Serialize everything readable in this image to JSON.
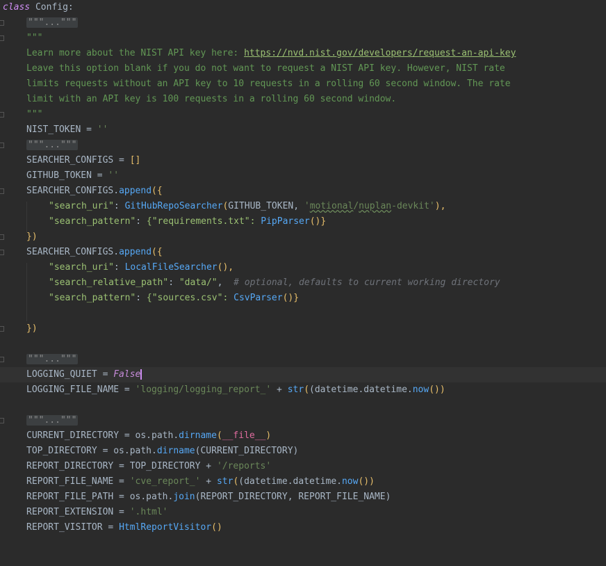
{
  "editor": {
    "lines": {
      "l1_kw": "class",
      "l1_name": " Config:",
      "fold": "\"\"\"...\"\"\"",
      "doc_open": "\"\"\"",
      "doc_l1_text": "Learn more about the NIST API key here: ",
      "doc_l1_link": "https://nvd.nist.gov/developers/request-an-api-key",
      "doc_l2": "Leave this option blank if you do not want to request a NIST API key. However, NIST rate",
      "doc_l3": "limits requests without an API key to 10 requests in a rolling 60 second window. The rate",
      "doc_l4": "limit with an API key is 100 requests in a rolling 60 second window.",
      "doc_close": "\"\"\"",
      "nist_token": "NIST_TOKEN = ",
      "nist_token_val": "''",
      "searcher_configs": "SEARCHER_CONFIGS = ",
      "searcher_configs_val": "[]",
      "github_token": "GITHUB_TOKEN = ",
      "github_token_val": "''",
      "sc_append_1": "SEARCHER_CONFIGS.",
      "append": "append",
      "open_paren_brace": "({",
      "search_uri_key": "\"search_uri\"",
      "colon": ": ",
      "github_repo_searcher": "GitHubRepoSearcher",
      "github_args_open": "(",
      "github_args_token": "GITHUB_TOKEN, ",
      "github_args_repo_q1": "'",
      "github_args_repo_a": "motional",
      "github_args_repo_slash": "/",
      "github_args_repo_b": "nuplan",
      "github_args_repo_c": "-devkit",
      "github_args_repo_q2": "'",
      "github_args_close": "),",
      "search_pattern_key": "\"search_pattern\"",
      "req_txt": "{\"requirements.txt\": ",
      "pip_parser": "PipParser",
      "pip_parser_call": "()}",
      "close_brace_paren": "})",
      "sc_append_2": "SEARCHER_CONFIGS.",
      "local_file_searcher": "LocalFileSearcher",
      "local_call": "(),",
      "search_rel_path_key": "\"search_relative_path\"",
      "data_path": "\"data/\"",
      "comma_sp": ",  ",
      "rel_comment": "# optional, defaults to current working directory",
      "sources_csv": "{\"sources.csv\": ",
      "csv_parser": "CsvParser",
      "csv_call": "()}",
      "close_brace_paren_2": "})",
      "logging_quiet": "LOGGING_QUIET = ",
      "false_val": "False",
      "logging_file_name": "LOGGING_FILE_NAME = ",
      "logging_path": "'logging/logging_report_'",
      "plus": " + ",
      "str_fn": "str",
      "dt_now_open": "(datetime.datetime.",
      "now_fn": "now",
      "dt_now_close": "())",
      "current_dir": "CURRENT_DIRECTORY = os.path.",
      "dirname": "dirname",
      "dunder_file_open": "(",
      "dunder_file": "__file__",
      "dunder_file_close": ")",
      "top_dir": "TOP_DIRECTORY = os.path.",
      "top_dir_args": "(CURRENT_DIRECTORY)",
      "report_dir": "REPORT_DIRECTORY = TOP_DIRECTORY + ",
      "reports_str": "'/reports'",
      "report_file_name": "REPORT_FILE_NAME = ",
      "cve_report_str": "'cve_report_'",
      "report_file_path": "REPORT_FILE_PATH = os.path.",
      "join_fn": "join",
      "join_args": "(REPORT_DIRECTORY, REPORT_FILE_NAME)",
      "report_ext": "REPORT_EXTENSION = ",
      "html_str": "'.html'",
      "report_visitor": "REPORT_VISITOR = ",
      "html_report_visitor": "HtmlReportVisitor",
      "hrv_call": "()"
    }
  }
}
